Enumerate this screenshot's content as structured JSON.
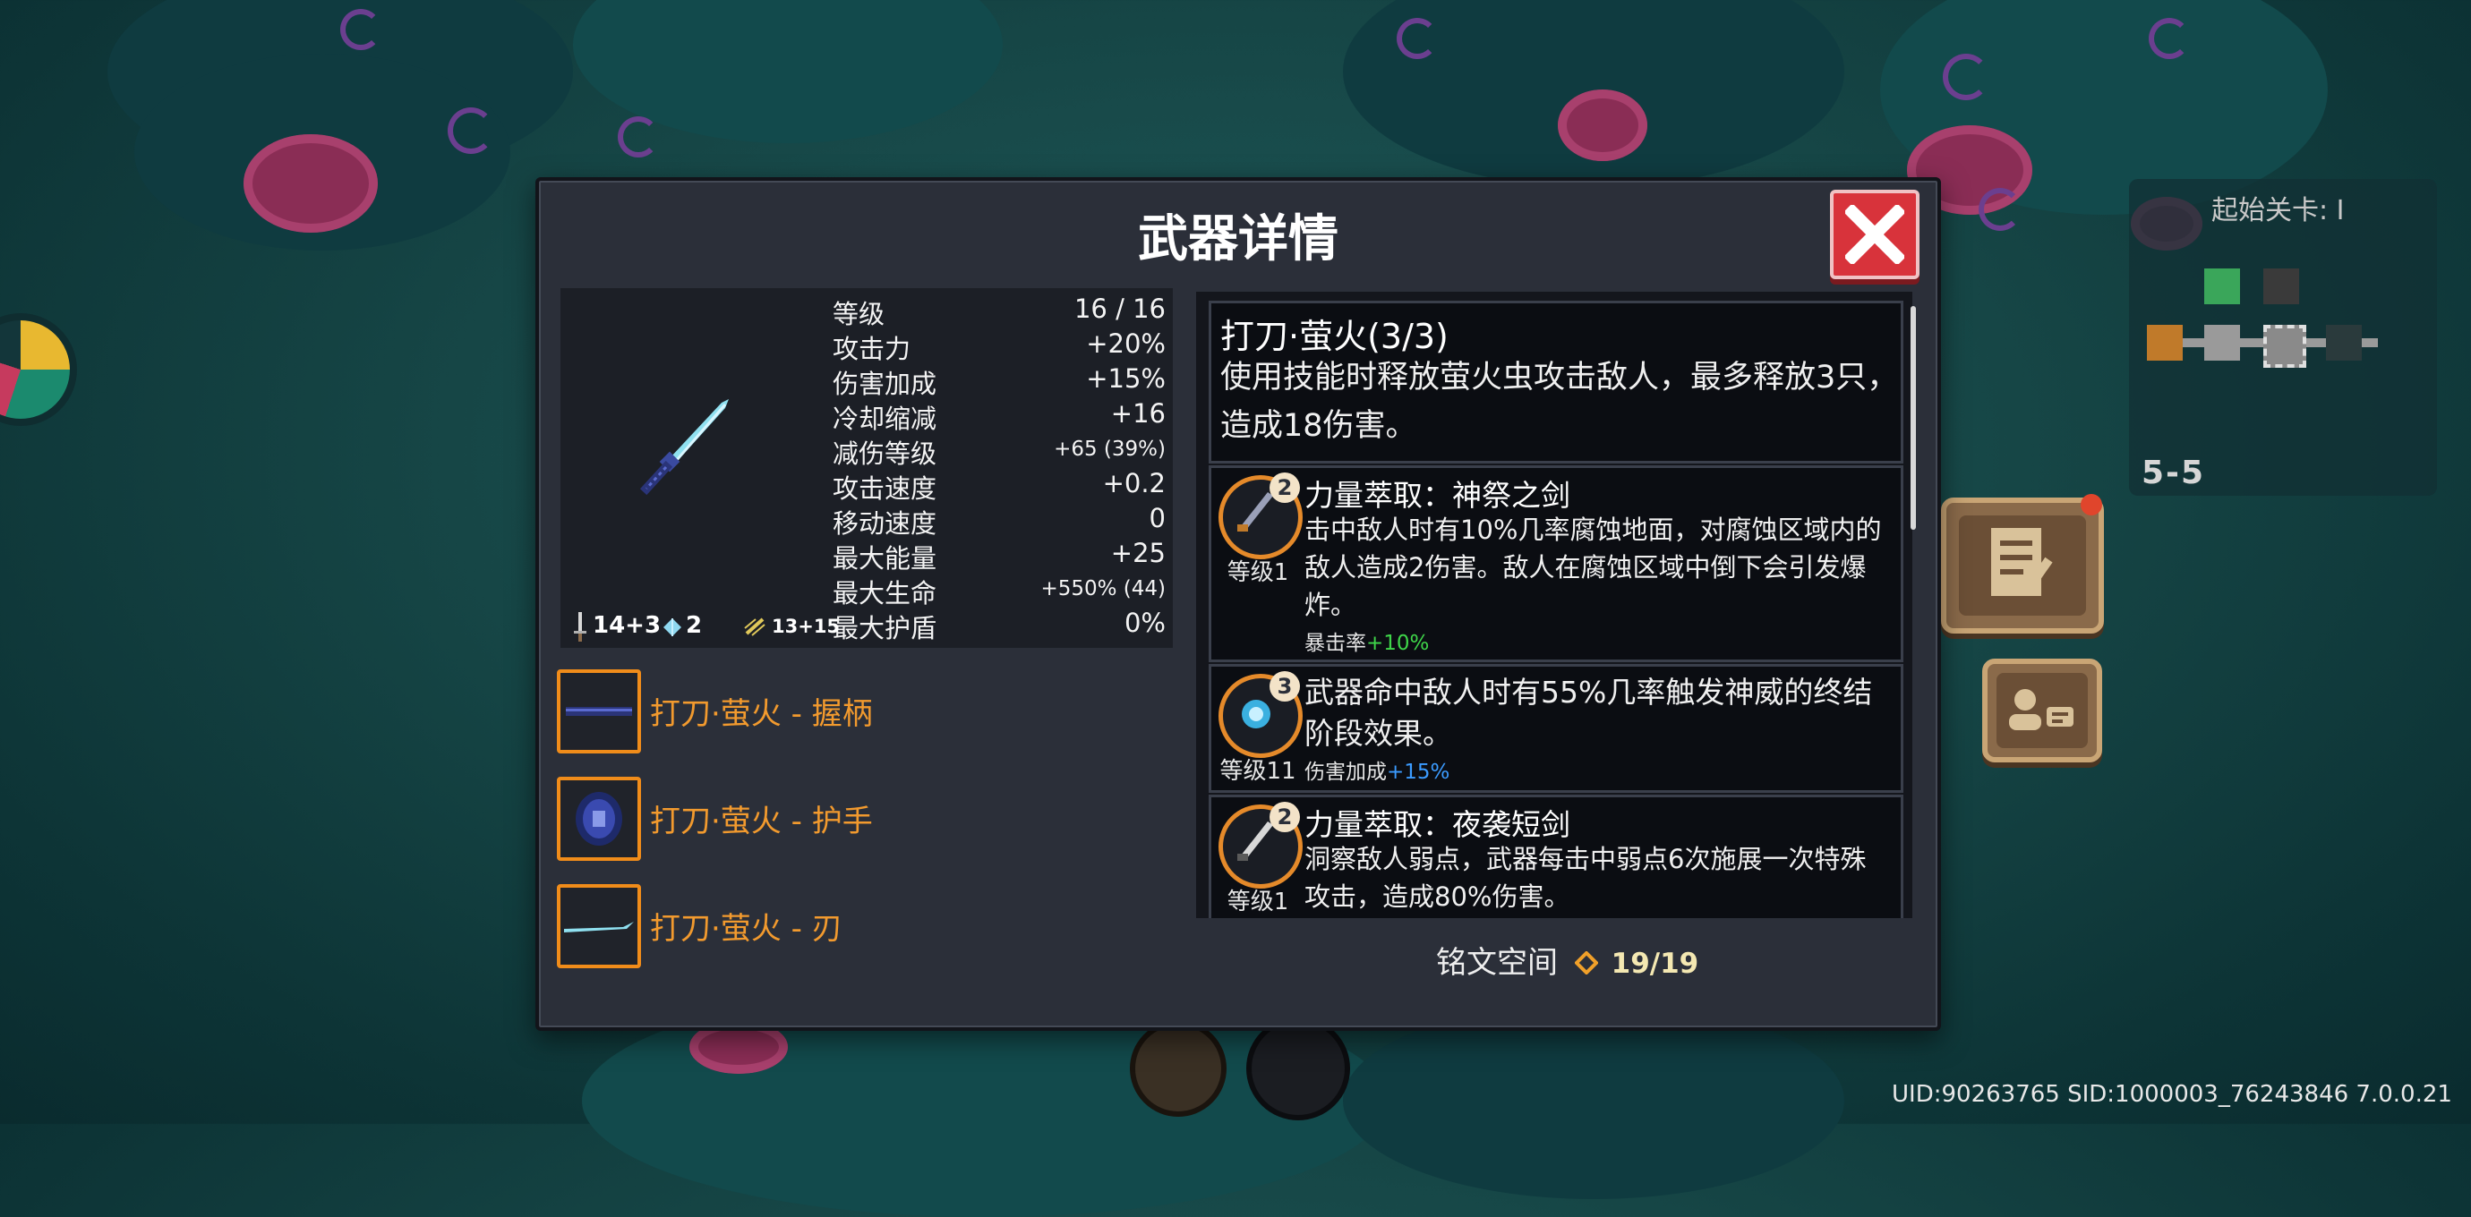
{
  "dialog": {
    "title": "武器详情"
  },
  "stats": [
    {
      "label": "等级",
      "value": "16 / 16"
    },
    {
      "label": "攻击力",
      "value": "+20%"
    },
    {
      "label": "伤害加成",
      "value": "+15%"
    },
    {
      "label": "冷却缩减",
      "value": "+16"
    },
    {
      "label": "减伤等级",
      "value": "+65 (39%)"
    },
    {
      "label": "攻击速度",
      "value": "+0.2"
    },
    {
      "label": "移动速度",
      "value": "0"
    },
    {
      "label": "最大能量",
      "value": "+25"
    },
    {
      "label": "最大生命",
      "value": "+550% (44)"
    },
    {
      "label": "最大护盾",
      "value": "0%"
    }
  ],
  "weapon_info": {
    "attack": "14+3",
    "gem": "2",
    "speed": "13+15"
  },
  "parts": [
    {
      "name": "打刀·萤火 - 握柄"
    },
    {
      "name": "打刀·萤火 - 护手"
    },
    {
      "name": "打刀·萤火 - 刃"
    }
  ],
  "effects": [
    {
      "title": "打刀·萤火(3/3)",
      "desc": "使用技能时释放萤火虫攻击敌人，最多释放3只，造成18伤害。"
    },
    {
      "badge": "2",
      "level": "等级1",
      "title": "力量萃取：神祭之剑",
      "desc": "击中敌人时有10%几率腐蚀地面，对腐蚀区域内的敌人造成2伤害。敌人在腐蚀区域中倒下会引发爆炸。",
      "bonus_label": "暴击率",
      "bonus_value": "+10%",
      "bonus_color": "#3fd64a"
    },
    {
      "badge": "3",
      "level": "等级11",
      "title": "武器命中敌人时有55%几率触发神威的终结阶段效果。",
      "bonus_label": "伤害加成",
      "bonus_value": "+15%",
      "bonus_color": "#3b9bff"
    },
    {
      "badge": "2",
      "level": "等级1",
      "title": "力量萃取：夜袭短剑",
      "desc": "洞察敌人弱点，武器每击中弱点6次施展一次特殊攻击，造成80%伤害。"
    }
  ],
  "inscription": {
    "label": "铭文空间",
    "value": "19/19"
  },
  "minimap": {
    "title": "起始关卡: I",
    "stage": "5-5"
  },
  "uid_text": "UID:90263765 SID:1000003_76243846 7.0.0.21",
  "colors": {
    "accent_orange": "#f29a2e",
    "close_red": "#d8333b"
  }
}
